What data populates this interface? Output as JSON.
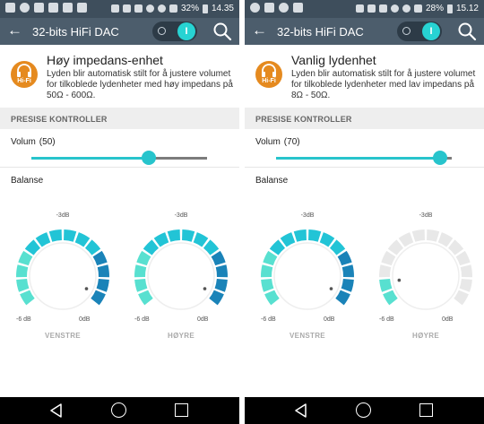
{
  "colors": {
    "status_bar": "#3e4e5c",
    "app_bar": "#4c5d6c",
    "accent": "#27c4cc",
    "hifi_badge": "#e58a1f",
    "section_bg": "#eeeeee",
    "dial_light": "#58e0d0",
    "dial_mid": "#22c4d6",
    "dial_dark": "#1a83b8",
    "dial_inactive": "#e8e8e8"
  },
  "screens": [
    {
      "status": {
        "time": "14.35",
        "battery": "32%",
        "left_icons": [
          "tools-icon",
          "settings-icon",
          "image-icon",
          "mail-icon",
          "image-icon",
          "download-icon"
        ],
        "right_icons": [
          "mobile-icon",
          "nfc-icon",
          "mute-icon",
          "wifi-icon",
          "alarm-icon",
          "signal-icon"
        ]
      },
      "appbar": {
        "title": "32-bits HiFi DAC",
        "toggle_on_label": "I"
      },
      "header": {
        "badge": "Hi-Fi",
        "title": "Høy impedans-enhet",
        "description": "Lyden blir automatisk stilt for å justere volumet for tilkoblede lydenheter med høy impedans på 50Ω - 600Ω."
      },
      "section_title": "PRESISE KONTROLLER",
      "volume": {
        "label": "Volum",
        "display": "(50)",
        "value": 50,
        "max": 75
      },
      "balance_label": "Balanse",
      "dials": [
        {
          "name": "VENSTRE",
          "top_label": "-3dB",
          "min_label": "-6 dB",
          "max_label": "0dB",
          "level": 1.0
        },
        {
          "name": "HØYRE",
          "top_label": "-3dB",
          "min_label": "-6 dB",
          "max_label": "0dB",
          "level": 1.0
        }
      ]
    },
    {
      "status": {
        "time": "15.12",
        "battery": "28%",
        "left_icons": [
          "spotify-icon",
          "image-icon",
          "settings-icon",
          "image-icon"
        ],
        "right_icons": [
          "hifi-icon",
          "nfc-icon",
          "mute-icon",
          "wifi-icon",
          "alarm-icon",
          "signal-icon"
        ]
      },
      "appbar": {
        "title": "32-bits HiFi DAC",
        "toggle_on_label": "I"
      },
      "header": {
        "badge": "Hi-Fi",
        "title": "Vanlig lydenhet",
        "description": "Lyden blir automatisk stilt for å justere volumet for tilkoblede lydenheter med lav impedans på 8Ω - 50Ω."
      },
      "section_title": "PRESISE KONTROLLER",
      "volume": {
        "label": "Volum",
        "display": "(70)",
        "value": 70,
        "max": 75
      },
      "balance_label": "Balanse",
      "dials": [
        {
          "name": "VENSTRE",
          "top_label": "-3dB",
          "min_label": "-6 dB",
          "max_label": "0dB",
          "level": 1.0
        },
        {
          "name": "HØYRE",
          "top_label": "-3dB",
          "min_label": "-6 dB",
          "max_label": "0dB",
          "level": 0.12
        }
      ]
    }
  ]
}
